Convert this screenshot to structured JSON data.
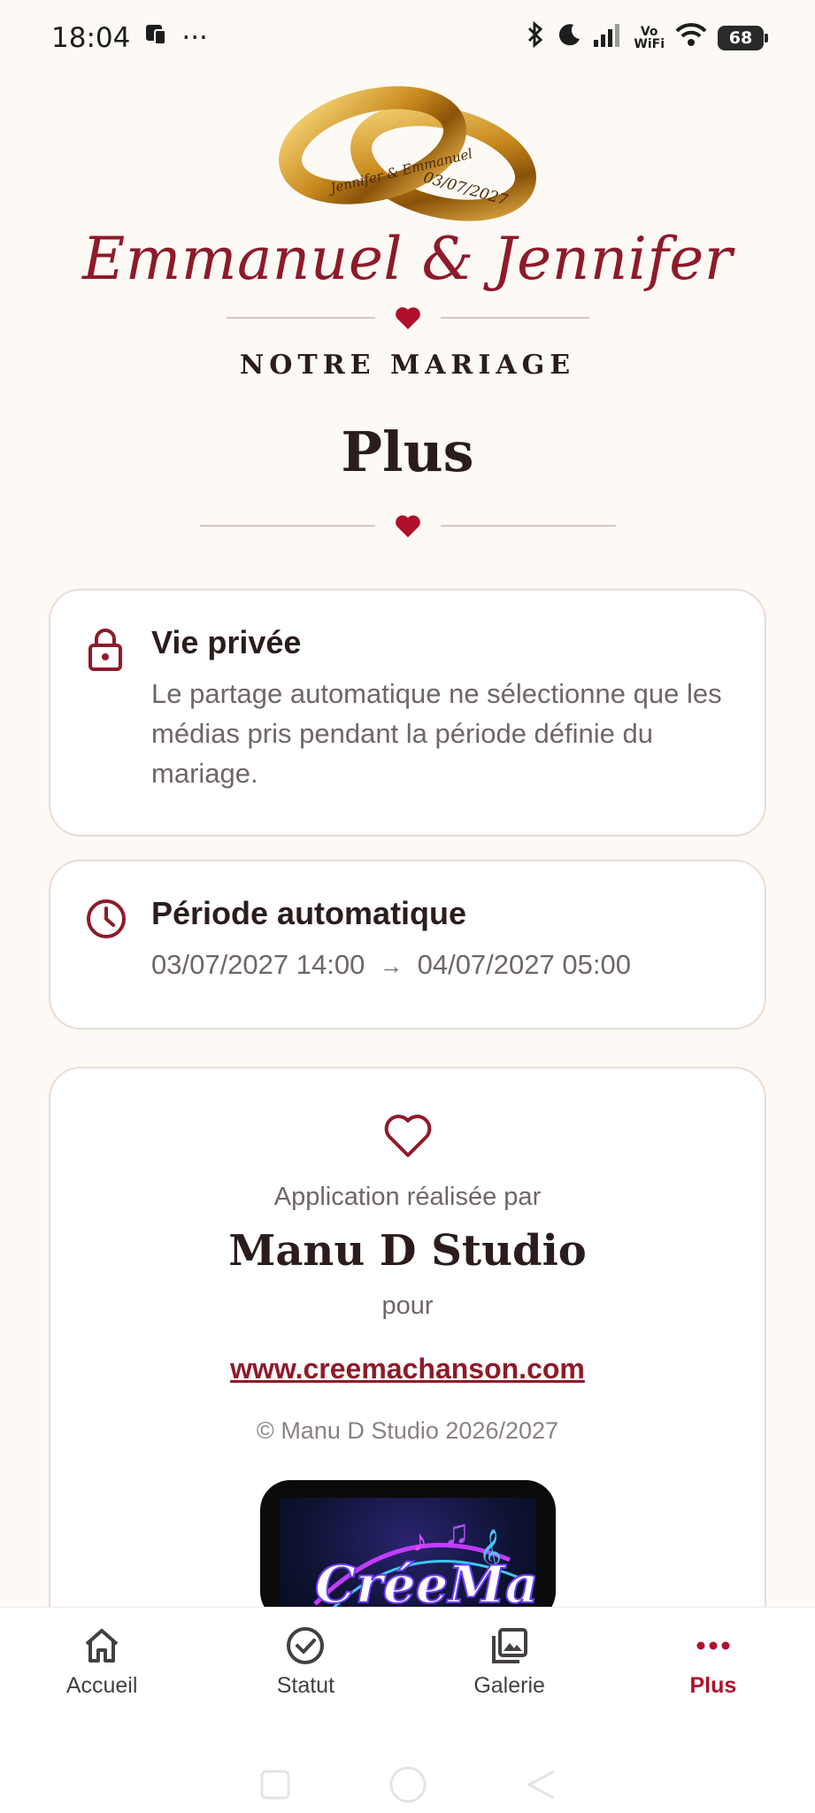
{
  "status_bar": {
    "time": "18:04",
    "more": "···",
    "network_label_top": "Vo",
    "network_label_bottom": "WiFi",
    "battery": "68"
  },
  "header": {
    "ring_inscription_left": "Jennifer & Emmanuel",
    "ring_inscription_right": "03/07/2027",
    "couple_names": "Emmanuel & Jennifer",
    "subtitle": "NOTRE MARIAGE"
  },
  "page": {
    "title": "Plus"
  },
  "privacy": {
    "title": "Vie privée",
    "text": "Le partage automatique ne sélectionne que les médias pris pendant la période définie du mariage."
  },
  "period": {
    "title": "Période automatique",
    "start": "03/07/2027 14:00",
    "arrow": "→",
    "end": "04/07/2027 05:00"
  },
  "credits": {
    "made_by": "Application réalisée par",
    "studio": "Manu D Studio",
    "for": "pour",
    "link": "www.creemachanson.com",
    "copyright": "© Manu D Studio 2026/2027",
    "logo_text": "CréeMa"
  },
  "nav": {
    "items": [
      {
        "label": "Accueil",
        "icon": "home-icon"
      },
      {
        "label": "Statut",
        "icon": "check-circle-icon"
      },
      {
        "label": "Galerie",
        "icon": "gallery-icon"
      },
      {
        "label": "Plus",
        "icon": "more-icon"
      }
    ],
    "active_index": 3
  },
  "colors": {
    "accent": "#8e1a2a",
    "active_nav": "#b0102a",
    "background": "#fdfaf5"
  }
}
